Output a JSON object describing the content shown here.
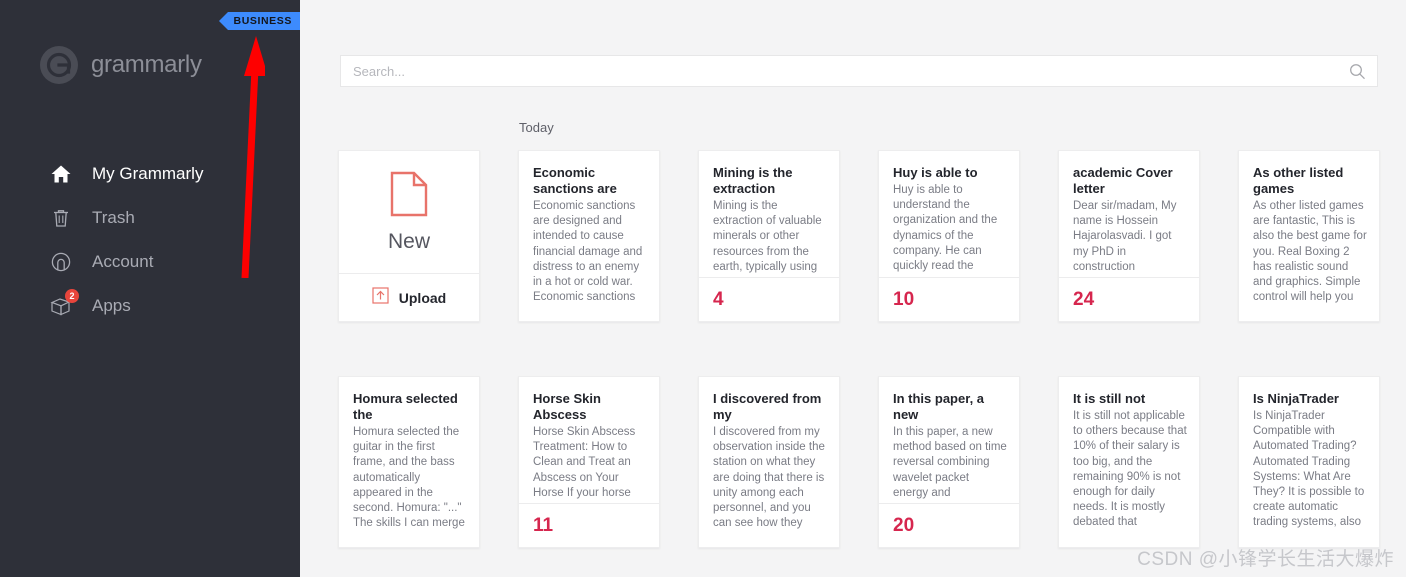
{
  "sidebar": {
    "badge": {
      "label": "BUSINESS",
      "color": "#3d8bfd"
    },
    "brand": {
      "name": "grammarly",
      "logo_icon": "grammarly-g-icon"
    },
    "items": [
      {
        "label": "My Grammarly",
        "icon": "home-icon",
        "active": true,
        "badge": ""
      },
      {
        "label": "Trash",
        "icon": "trash-icon",
        "active": false,
        "badge": ""
      },
      {
        "label": "Account",
        "icon": "account-icon",
        "active": false,
        "badge": ""
      },
      {
        "label": "Apps",
        "icon": "apps-box-icon",
        "active": false,
        "badge": "2"
      }
    ],
    "annotation": {
      "type": "red-arrow",
      "color": "#fe0000"
    }
  },
  "main": {
    "search": {
      "placeholder": "Search...",
      "value": "",
      "icon": "search-icon"
    },
    "section_label": "Today",
    "new_card": {
      "new_label": "New",
      "new_icon": "document-page-icon",
      "upload_label": "Upload",
      "upload_icon": "upload-arrow-icon"
    },
    "documents": [
      {
        "title": "Economic sanctions are",
        "snippet": "Economic sanctions are designed and intended to cause financial damage and distress to an enemy in a hot or cold war. Economic sanctions",
        "score": ""
      },
      {
        "title": "Mining is the extraction",
        "snippet": "Mining is the extraction of valuable minerals or other resources from the earth, typically using",
        "score": "4"
      },
      {
        "title": "Huy is able to",
        "snippet": "Huy is able to understand the organization and the dynamics of the company. He can quickly read the",
        "score": "10"
      },
      {
        "title": "academic Cover letter",
        "snippet": "Dear sir/madam, My name is Hossein Hajarolasvadi. I got my PhD in construction",
        "score": "24"
      },
      {
        "title": "As other listed games",
        "snippet": "As other listed games are fantastic, This is also the best game for you. Real Boxing 2 has realistic sound and graphics. Simple control will help you",
        "score": ""
      },
      {
        "title": "Homura selected the",
        "snippet": "Homura selected the guitar in the first frame, and the bass automatically appeared in the second. Homura: \"...\" The skills I can merge",
        "score": ""
      },
      {
        "title": "Horse Skin Abscess",
        "snippet": "Horse Skin Abscess Treatment: How to Clean and Treat an Abscess on Your Horse If your horse",
        "score": "11"
      },
      {
        "title": "I discovered from my",
        "snippet": "I discovered from my observation inside the station on what they are doing that there is unity among each personnel, and you can see how they",
        "score": ""
      },
      {
        "title": "In this paper, a new",
        "snippet": "In this paper, a new method based on time reversal combining wavelet packet energy and",
        "score": "20"
      },
      {
        "title": "It is still not",
        "snippet": "It is still not applicable to others because that 10% of their salary is too big, and the remaining 90% is not enough for daily needs. It is mostly debated that",
        "score": ""
      },
      {
        "title": "Is NinjaTrader",
        "snippet": "Is NinjaTrader Compatible with Automated Trading? Automated Trading Systems: What Are They? It is possible to create automatic trading systems, also",
        "score": ""
      }
    ],
    "score_color": "#d6264e"
  },
  "watermark": "CSDN @小锋学长生活大爆炸"
}
